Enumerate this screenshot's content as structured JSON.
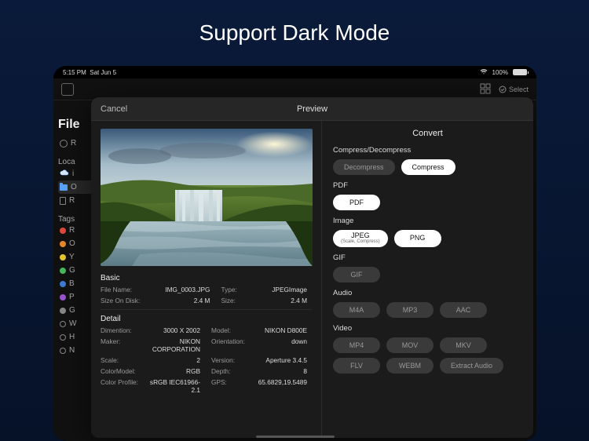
{
  "hero": "Support Dark Mode",
  "statusbar": {
    "time": "5:15 PM",
    "date": "Sat Jun 5",
    "battery": "100%"
  },
  "app": {
    "select_label": "Select"
  },
  "sidebar": {
    "title": "File",
    "recent_first_char": "R",
    "locations_label": "Loca",
    "icloud_char": "i",
    "on_device_char": "O",
    "trash_char": "R",
    "tags_label": "Tags",
    "tags": [
      {
        "color": "#e24a3b",
        "char": "R"
      },
      {
        "color": "#e88a2c",
        "char": "O"
      },
      {
        "color": "#e8c92c",
        "char": "Y"
      },
      {
        "color": "#49b85c",
        "char": "G"
      },
      {
        "color": "#3d7bd8",
        "char": "B"
      },
      {
        "color": "#9a56d0",
        "char": "P"
      },
      {
        "color": "#888888",
        "char": "G"
      },
      {
        "color": "",
        "char": "W"
      },
      {
        "color": "",
        "char": "H"
      },
      {
        "color": "",
        "char": "N"
      }
    ]
  },
  "modal": {
    "cancel": "Cancel",
    "title": "Preview",
    "basic": {
      "heading": "Basic",
      "rows": [
        {
          "k1": "File Name:",
          "v1": "IMG_0003.JPG",
          "k2": "Type:",
          "v2": "JPEGImage"
        },
        {
          "k1": "Size On Disk:",
          "v1": "2.4 M",
          "k2": "Size:",
          "v2": "2.4 M"
        }
      ]
    },
    "detail": {
      "heading": "Detail",
      "rows": [
        {
          "k1": "Dimention:",
          "v1": "3000 X 2002",
          "k2": "Model:",
          "v2": "NIKON D800E"
        },
        {
          "k1": "Maker:",
          "v1": "NIKON CORPORATION",
          "k2": "Orientation:",
          "v2": "down"
        },
        {
          "k1": "Scale:",
          "v1": "2",
          "k2": "Version:",
          "v2": "Aperture 3.4.5"
        },
        {
          "k1": "ColorModel:",
          "v1": "RGB",
          "k2": "Depth:",
          "v2": "8"
        },
        {
          "k1": "Color Profile:",
          "v1": "sRGB IEC61966-2.1",
          "k2": "GPS:",
          "v2": "65.6829,19.5489"
        }
      ]
    }
  },
  "convert": {
    "title": "Convert",
    "groups": {
      "compress": {
        "label": "Compress/Decompress",
        "decompress": "Decompress",
        "compress": "Compress"
      },
      "pdf": {
        "label": "PDF",
        "pdf": "PDF"
      },
      "image": {
        "label": "Image",
        "jpeg": "JPEG",
        "jpeg_sub": "(Scale, Compress)",
        "png": "PNG"
      },
      "gif": {
        "label": "GIF",
        "gif": "GIF"
      },
      "audio": {
        "label": "Audio",
        "m4a": "M4A",
        "mp3": "MP3",
        "aac": "AAC"
      },
      "video": {
        "label": "Video",
        "mp4": "MP4",
        "mov": "MOV",
        "mkv": "MKV",
        "flv": "FLV",
        "webm": "WEBM",
        "extract": "Extract Audio"
      }
    }
  }
}
